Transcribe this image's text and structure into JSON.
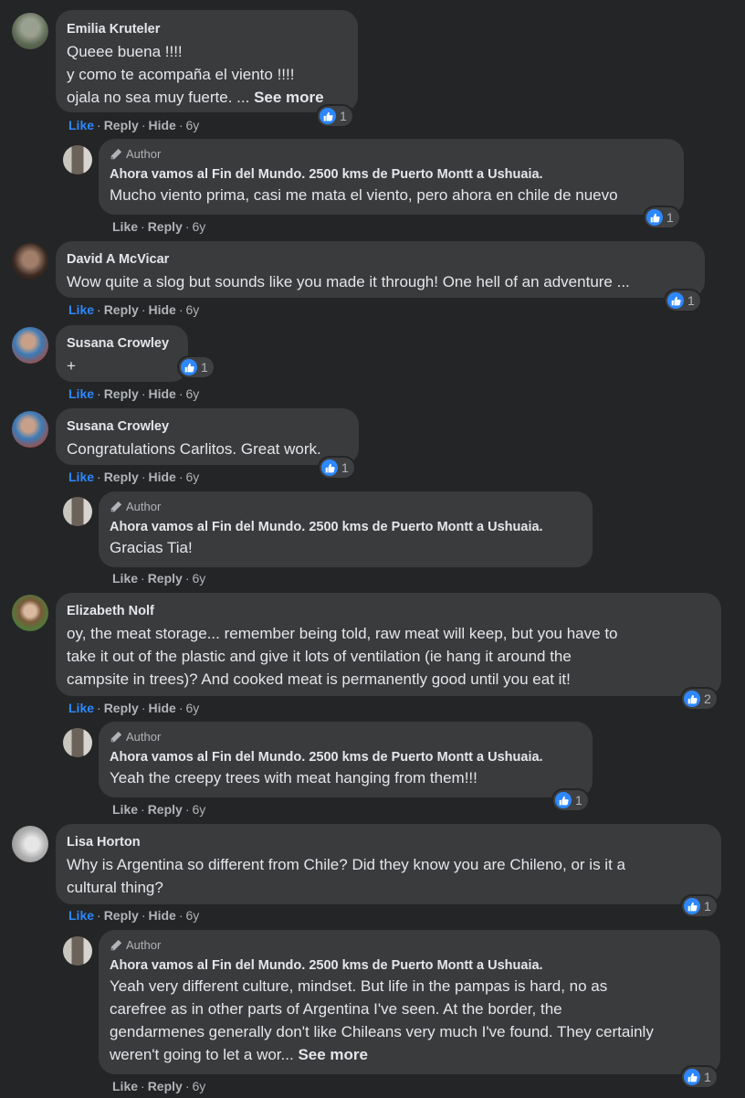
{
  "author_label": "Author",
  "actions": {
    "like": "Like",
    "reply": "Reply",
    "hide": "Hide",
    "see_more": "See more"
  },
  "comments": [
    {
      "name": "Emilia Kruteler",
      "text": "Queee buena !!!!\ny como te acompaña el viento !!!!\nojala no sea muy fuerte. ...",
      "time": "6y",
      "reactions": "1"
    },
    {
      "name": "Ahora vamos al Fin del Mundo. 2500 kms de Puerto Montt a Ushuaia.",
      "text": "Mucho viento prima, casi me mata el viento, pero ahora en chile de nuevo",
      "time": "6y",
      "reactions": "1"
    },
    {
      "name": "David A McVicar",
      "text": "Wow quite a slog but sounds like you made it through! One hell of an adventure ...",
      "time": "6y",
      "reactions": "1"
    },
    {
      "name": "Susana Crowley",
      "text": "+",
      "time": "6y",
      "reactions": "1"
    },
    {
      "name": "Susana Crowley",
      "text": "Congratulations Carlitos. Great work.",
      "time": "6y",
      "reactions": "1"
    },
    {
      "name": "Ahora vamos al Fin del Mundo. 2500 kms de Puerto Montt a Ushuaia.",
      "text": "Gracias Tia!",
      "time": "6y"
    },
    {
      "name": "Elizabeth Nolf",
      "text": "oy, the meat storage... remember being told, raw meat will keep, but you have to\ntake it out of the plastic and give it lots of ventilation (ie hang it around the\ncampsite in trees)? And cooked meat is permanently good until you eat it!",
      "time": "6y",
      "reactions": "2"
    },
    {
      "name": "Ahora vamos al Fin del Mundo. 2500 kms de Puerto Montt a Ushuaia.",
      "text": "Yeah the creepy trees with meat hanging from them!!!",
      "time": "6y",
      "reactions": "1"
    },
    {
      "name": "Lisa Horton",
      "text": "Why is Argentina so different from Chile? Did they know you are Chileno, or is it a\ncultural thing?",
      "time": "6y",
      "reactions": "1"
    },
    {
      "name": "Ahora vamos al Fin del Mundo. 2500 kms de Puerto Montt a Ushuaia.",
      "text": "Yeah very different culture, mindset. But life in the pampas is hard, no as\ncarefree as in other parts of Argentina I've seen. At the border, the\ngendarmenes generally don't like Chileans very much I've found. They certainly\nweren't going to let a wor...",
      "time": "6y",
      "reactions": "1"
    }
  ],
  "colors": {
    "background": "#242526",
    "bubble": "#3a3b3c",
    "link": "#2d88ff",
    "secondary_text": "#b0b3b8"
  }
}
